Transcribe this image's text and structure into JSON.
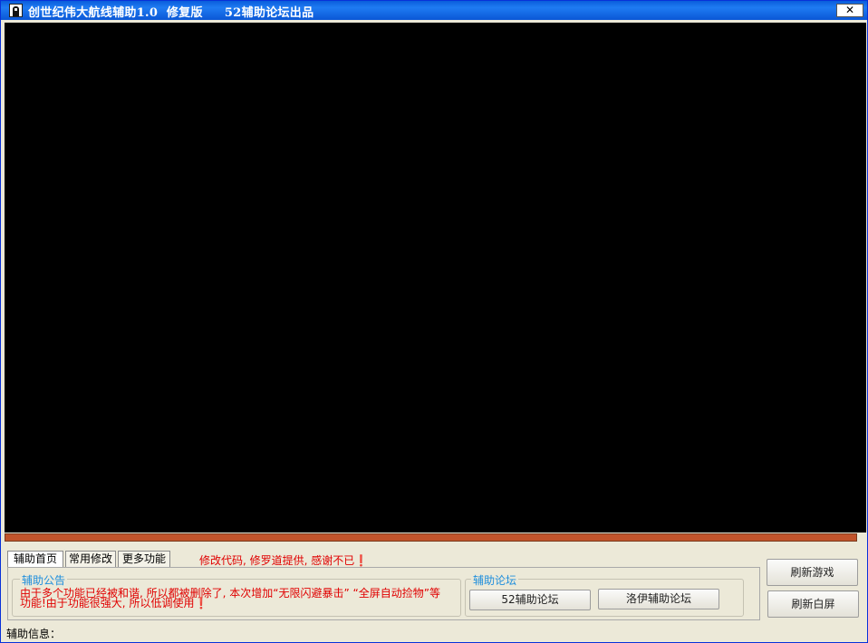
{
  "window": {
    "title": "创世纪伟大航线辅助1.0  修复版     52辅助论坛出品",
    "close_label": "✕"
  },
  "game": {
    "progress_fraction": 1.0,
    "progress_color": "#c1542b"
  },
  "tabs": [
    {
      "label": "辅助首页",
      "active": true
    },
    {
      "label": "常用修改",
      "active": false
    },
    {
      "label": "更多功能",
      "active": false
    }
  ],
  "tab_notice": "修改代码, 修罗道提供, 感谢不已❗",
  "announcement": {
    "title": "辅助公告",
    "text": "由于多个功能已经被和谐, 所以都被删除了, 本次增加“无限闪避暴击”   “全屏自动捡物”等功能!由于功能很强大, 所以低调使用❗"
  },
  "forum": {
    "title": "辅助论坛",
    "buttons": [
      "52辅助论坛",
      "洛伊辅助论坛"
    ]
  },
  "side_buttons": {
    "refresh_game": "刷新游戏",
    "refresh_blank": "刷新白屏"
  },
  "status": {
    "label": "辅助信息："
  },
  "colors": {
    "title_bar": "#0a5ddc",
    "notice_red": "#e00000",
    "group_label": "#1e8edc"
  }
}
